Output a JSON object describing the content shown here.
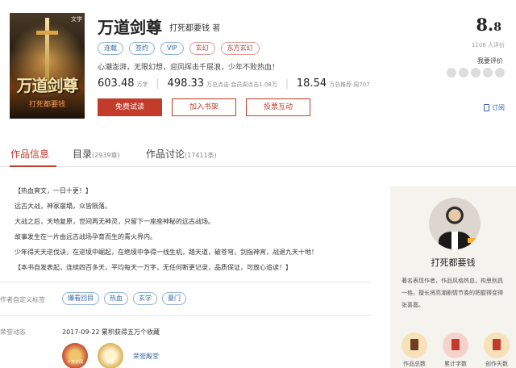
{
  "book": {
    "cover_title": "万道剑尊",
    "cover_author": "打死都要钱",
    "cover_tag": "文学",
    "title": "万道剑尊",
    "author": "打死都要钱",
    "author_suffix": "著",
    "tags": [
      "连载",
      "签约",
      "VIP",
      "玄幻",
      "东方玄幻"
    ],
    "intro": "心潮澎湃，无限幻想，迎风挥击千层浪，少年不败热血！",
    "stats": [
      {
        "value": "603.48",
        "unit": "万字"
      },
      {
        "value": "498.33",
        "unit": "万总点击·会员周点击1.08万"
      },
      {
        "value": "18.54",
        "unit": "万总推荐·周707"
      }
    ]
  },
  "actions": {
    "read": "免费试读",
    "shelf": "加入书架",
    "vote": "投票互动"
  },
  "rating": {
    "score_int": "8.",
    "score_dec": "8",
    "count": "1108 人评价",
    "rate_link": "我要评价",
    "stars": 5
  },
  "catalog_link": "订阅",
  "tabs": [
    {
      "label": "作品信息",
      "count": ""
    },
    {
      "label": "目录",
      "count": "(2939章)"
    },
    {
      "label": "作品讨论",
      "count": "(17411条)"
    }
  ],
  "description": [
    "【热血爽文，一日十更！】",
    "远古大战，神冢崩塌，众皆陨落。",
    "大战之后，天地复原，世间再无神灵，只留下一座座神秘的远古战场。",
    "故事发生在一片由远古战场孕育而生的青火界内。",
    "少年得天天逆伐诀，在逆境中崛起，在绝境中争得一线生机，踏天道，破苍穹，剑指神宵，战退九天十地！",
    "【本书自发表起，连续四百多天，平均每天一万字，无任何断更记录，品质保证，可放心追读！】"
  ],
  "custom_tags": {
    "label": "作者自定义标签",
    "items": [
      "爆看回目",
      "热血",
      "玄学",
      "豪门"
    ]
  },
  "honors": {
    "label": "荣誉动态",
    "text": "2017-09-22 累积获得五万个收藏",
    "link": "荣誉殿堂",
    "medals": [
      "十万订阅",
      "新星"
    ]
  },
  "aside": {
    "author_name": "打死都要钱",
    "bio": "著名表现作者，作品风格热血，构思别具一格，擅长将高潮剧情节奏的把握得变得张喜嘉。",
    "icons": [
      "作品总数",
      "累计字数",
      "创作天数"
    ]
  },
  "colors": {
    "accent": "#c23b2b",
    "link": "#3566a8"
  }
}
